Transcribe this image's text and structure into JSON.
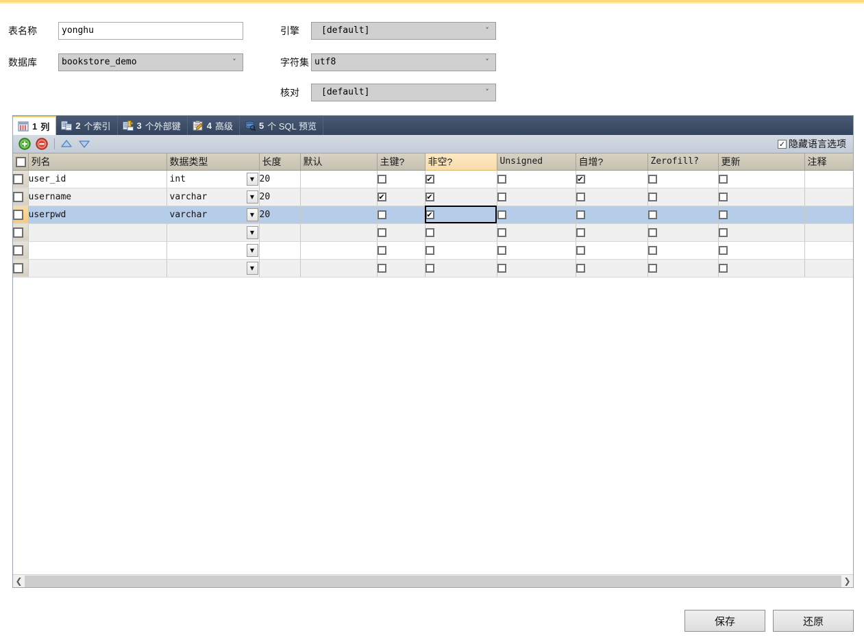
{
  "form": {
    "table_name_label": "表名称",
    "table_name_value": "yonghu",
    "database_label": "数据库",
    "database_value": "bookstore_demo",
    "engine_label": "引擎",
    "engine_value": "[default]",
    "charset_label": "字符集",
    "charset_value": "utf8",
    "collation_label": "核对",
    "collation_value": "[default]"
  },
  "tabs": [
    {
      "num": "1",
      "label": "列",
      "icon": "columns-icon",
      "active": true
    },
    {
      "num": "2",
      "label": "个索引",
      "icon": "index-icon",
      "active": false
    },
    {
      "num": "3",
      "label": "个外部键",
      "icon": "foreign-key-icon",
      "active": false
    },
    {
      "num": "4",
      "label": "高级",
      "icon": "advanced-icon",
      "active": false
    },
    {
      "num": "5",
      "label": "个 SQL 预览",
      "icon": "sql-preview-icon",
      "active": false
    }
  ],
  "toolbar": {
    "add_label": "添加栏位",
    "remove_label": "删除栏位",
    "move_up_label": "上移",
    "move_down_label": "下移",
    "hide_lang_label": "隐藏语言选项",
    "hide_lang_checked": true,
    "check_glyph": "✓"
  },
  "grid": {
    "columns": [
      {
        "key": "name",
        "label": "列名",
        "mono": false,
        "selected": false
      },
      {
        "key": "type",
        "label": "数据类型",
        "mono": false,
        "selected": false
      },
      {
        "key": "length",
        "label": "长度",
        "mono": false,
        "selected": false
      },
      {
        "key": "default",
        "label": "默认",
        "mono": false,
        "selected": false
      },
      {
        "key": "pk",
        "label": "主键?",
        "mono": false,
        "selected": false
      },
      {
        "key": "notnull",
        "label": "非空?",
        "mono": false,
        "selected": true
      },
      {
        "key": "unsigned",
        "label": "Unsigned",
        "mono": true,
        "selected": false
      },
      {
        "key": "autoinc",
        "label": "自增?",
        "mono": false,
        "selected": false
      },
      {
        "key": "zerofill",
        "label": "Zerofill?",
        "mono": true,
        "selected": false
      },
      {
        "key": "update",
        "label": "更新",
        "mono": false,
        "selected": false
      },
      {
        "key": "comment",
        "label": "注释",
        "mono": false,
        "selected": false
      }
    ],
    "rows": [
      {
        "name": "user_id",
        "type": "int",
        "length": "20",
        "default": "",
        "pk": false,
        "notnull": true,
        "unsigned": false,
        "autoinc": true,
        "zerofill": false,
        "update": false,
        "comment": "",
        "selected": false,
        "focus_cell": ""
      },
      {
        "name": "username",
        "type": "varchar",
        "length": "20",
        "default": "",
        "pk": true,
        "notnull": true,
        "unsigned": false,
        "autoinc": false,
        "zerofill": false,
        "update": false,
        "comment": "",
        "selected": false,
        "focus_cell": ""
      },
      {
        "name": "userpwd",
        "type": "varchar",
        "length": "20",
        "default": "",
        "pk": false,
        "notnull": true,
        "unsigned": false,
        "autoinc": false,
        "zerofill": false,
        "update": false,
        "comment": "",
        "selected": true,
        "focus_cell": "notnull"
      },
      {
        "name": "",
        "type": "",
        "length": "",
        "default": "",
        "pk": false,
        "notnull": false,
        "unsigned": false,
        "autoinc": false,
        "zerofill": false,
        "update": false,
        "comment": "",
        "selected": false,
        "focus_cell": ""
      },
      {
        "name": "",
        "type": "",
        "length": "",
        "default": "",
        "pk": false,
        "notnull": false,
        "unsigned": false,
        "autoinc": false,
        "zerofill": false,
        "update": false,
        "comment": "",
        "selected": false,
        "focus_cell": ""
      },
      {
        "name": "",
        "type": "",
        "length": "",
        "default": "",
        "pk": false,
        "notnull": false,
        "unsigned": false,
        "autoinc": false,
        "zerofill": false,
        "update": false,
        "comment": "",
        "selected": false,
        "focus_cell": ""
      }
    ],
    "check_glyph": "✔",
    "dropdown_glyph": "▼"
  },
  "scrollbar": {
    "left_arrow": "❮",
    "right_arrow": "❯"
  },
  "footer": {
    "save_label": "保存",
    "revert_label": "还原"
  },
  "colors": {
    "accent_top": "#fdd978",
    "tab_bar": "#3a4a63",
    "selection": "#b6cdea",
    "header": "#cfcabb",
    "header_selected": "#f8dcab"
  }
}
